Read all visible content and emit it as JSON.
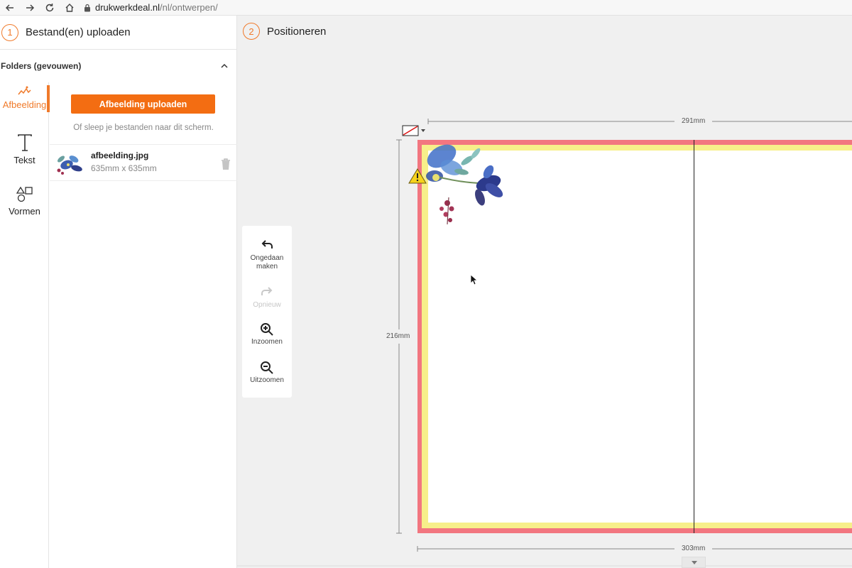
{
  "browser": {
    "url_domain": "drukwerkdeal.nl",
    "url_path": "/nl/ontwerpen/"
  },
  "step1": {
    "number": "1",
    "title": "Bestand(en) uploaden"
  },
  "folders": {
    "label": "Folders (gevouwen)"
  },
  "tools": [
    {
      "label": "Afbeelding",
      "icon": "image-wave-icon",
      "active": true
    },
    {
      "label": "Tekst",
      "icon": "text-t-icon",
      "active": false
    },
    {
      "label": "Vormen",
      "icon": "shapes-icon",
      "active": false
    }
  ],
  "upload": {
    "button_label": "Afbeelding uploaden",
    "hint": "Of sleep je bestanden naar dit scherm."
  },
  "file": {
    "name": "afbeelding.jpg",
    "size": "635mm x 635mm"
  },
  "step2": {
    "number": "2",
    "title": "Positioneren"
  },
  "canvas_tools": [
    {
      "label": "Ongedaan maken",
      "icon": "undo-icon",
      "enabled": true
    },
    {
      "label": "Opnieuw",
      "icon": "redo-icon",
      "enabled": false
    },
    {
      "label": "Inzoomen",
      "icon": "zoom-in-icon",
      "enabled": true
    },
    {
      "label": "Uitzoomen",
      "icon": "zoom-out-icon",
      "enabled": true
    }
  ],
  "dimensions": {
    "top_width": "291mm",
    "height": "216mm",
    "bottom_width": "303mm"
  },
  "colors": {
    "accent": "#f36d12",
    "bleed": "#f27680",
    "safe_zone": "#f7ef8a"
  }
}
